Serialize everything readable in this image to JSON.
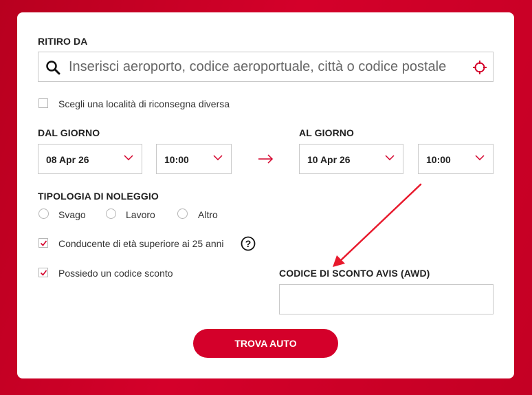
{
  "pickup": {
    "label": "RITIRO DA",
    "placeholder": "Inserisci aeroporto, codice aeroportuale, città o codice postale"
  },
  "different_return": {
    "label": "Scegli una località di riconsegna diversa",
    "checked": false
  },
  "from": {
    "label": "DAL GIORNO",
    "date": "08 Apr 26",
    "time": "10:00"
  },
  "to": {
    "label": "AL GIORNO",
    "date": "10 Apr 26",
    "time": "10:00"
  },
  "rental_type": {
    "label": "TIPOLOGIA DI NOLEGGIO",
    "options": [
      "Svago",
      "Lavoro",
      "Altro"
    ]
  },
  "driver_age": {
    "label": "Conducente di età superiore ai 25 anni",
    "checked": true
  },
  "discount": {
    "label": "Possiedo un codice sconto",
    "checked": true
  },
  "awd": {
    "label": "CODICE DI SCONTO AVIS (AWD)",
    "value": ""
  },
  "submit": {
    "label": "TROVA AUTO"
  },
  "colors": {
    "accent": "#d4002a",
    "annotation_arrow": "#e8192c"
  }
}
